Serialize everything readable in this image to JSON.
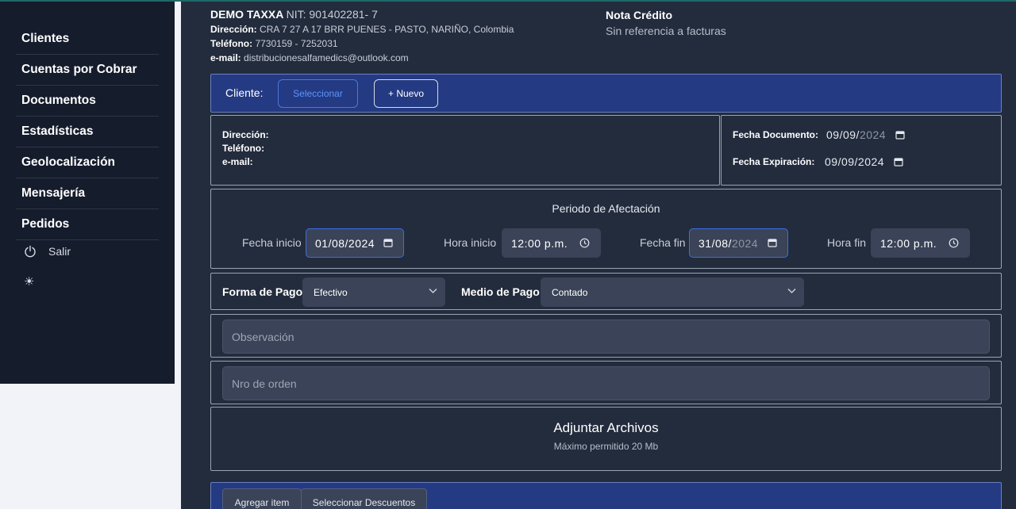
{
  "sidebar": {
    "items": [
      {
        "label": "Clientes"
      },
      {
        "label": "Cuentas por Cobrar"
      },
      {
        "label": "Documentos"
      },
      {
        "label": "Estadísticas"
      },
      {
        "label": "Geolocalización"
      },
      {
        "label": "Mensajería"
      },
      {
        "label": "Pedidos"
      }
    ],
    "logout_label": "Salir",
    "theme_icon": "sun-icon"
  },
  "company": {
    "name": "DEMO TAXXA",
    "nit": "NIT: 901402281- 7",
    "address_label": "Dirección:",
    "address": "CRA 7 27 A 17 BRR PUENES - PASTO, NARIÑO, Colombia",
    "phone_label": "Teléfono:",
    "phone": "7730159 - 7252031",
    "email_label": "e-mail:",
    "email": "distribucionesalfamedics@outlook.com"
  },
  "document": {
    "type": "Nota Crédito",
    "reference": "Sin referencia a facturas"
  },
  "client": {
    "label": "Cliente:",
    "select_label": "Seleccionar",
    "new_label": "+ Nuevo",
    "address_label": "Dirección:",
    "phone_label": "Teléfono:",
    "email_label": "e-mail:"
  },
  "dates": {
    "doc_label": "Fecha Documento:",
    "doc_value_a": "09/09/",
    "doc_value_b": "2024",
    "exp_label": "Fecha Expiración:",
    "exp_value": "09/09/2024"
  },
  "period": {
    "title": "Periodo de Afectación",
    "start_date_label": "Fecha inicio",
    "start_date_value": "01/08/2024",
    "start_time_label": "Hora inicio",
    "start_time_value": "12:00 p.m.",
    "end_date_label": "Fecha fin",
    "end_date_value_a": "31/08/",
    "end_date_value_b": "2024",
    "end_time_label": "Hora fin",
    "end_time_value": "12:00 p.m."
  },
  "payment": {
    "form_label": "Forma de Pago",
    "form_value": "Efectivo",
    "method_label": "Medio de Pago",
    "method_value": "Contado"
  },
  "fields": {
    "observation_placeholder": "Observación",
    "order_placeholder": "Nro de orden"
  },
  "attachments": {
    "title": "Adjuntar Archivos",
    "limit": "Máximo permitido 20 Mb"
  },
  "items_tabs": {
    "add_item": "Agregar item",
    "select_discounts": "Seleccionar Descuentos"
  },
  "colors": {
    "sidebar_bg": "#151c2c",
    "main_bg": "#232c3d",
    "accent_bar": "#243a82",
    "primary_link": "#5c95ff"
  }
}
